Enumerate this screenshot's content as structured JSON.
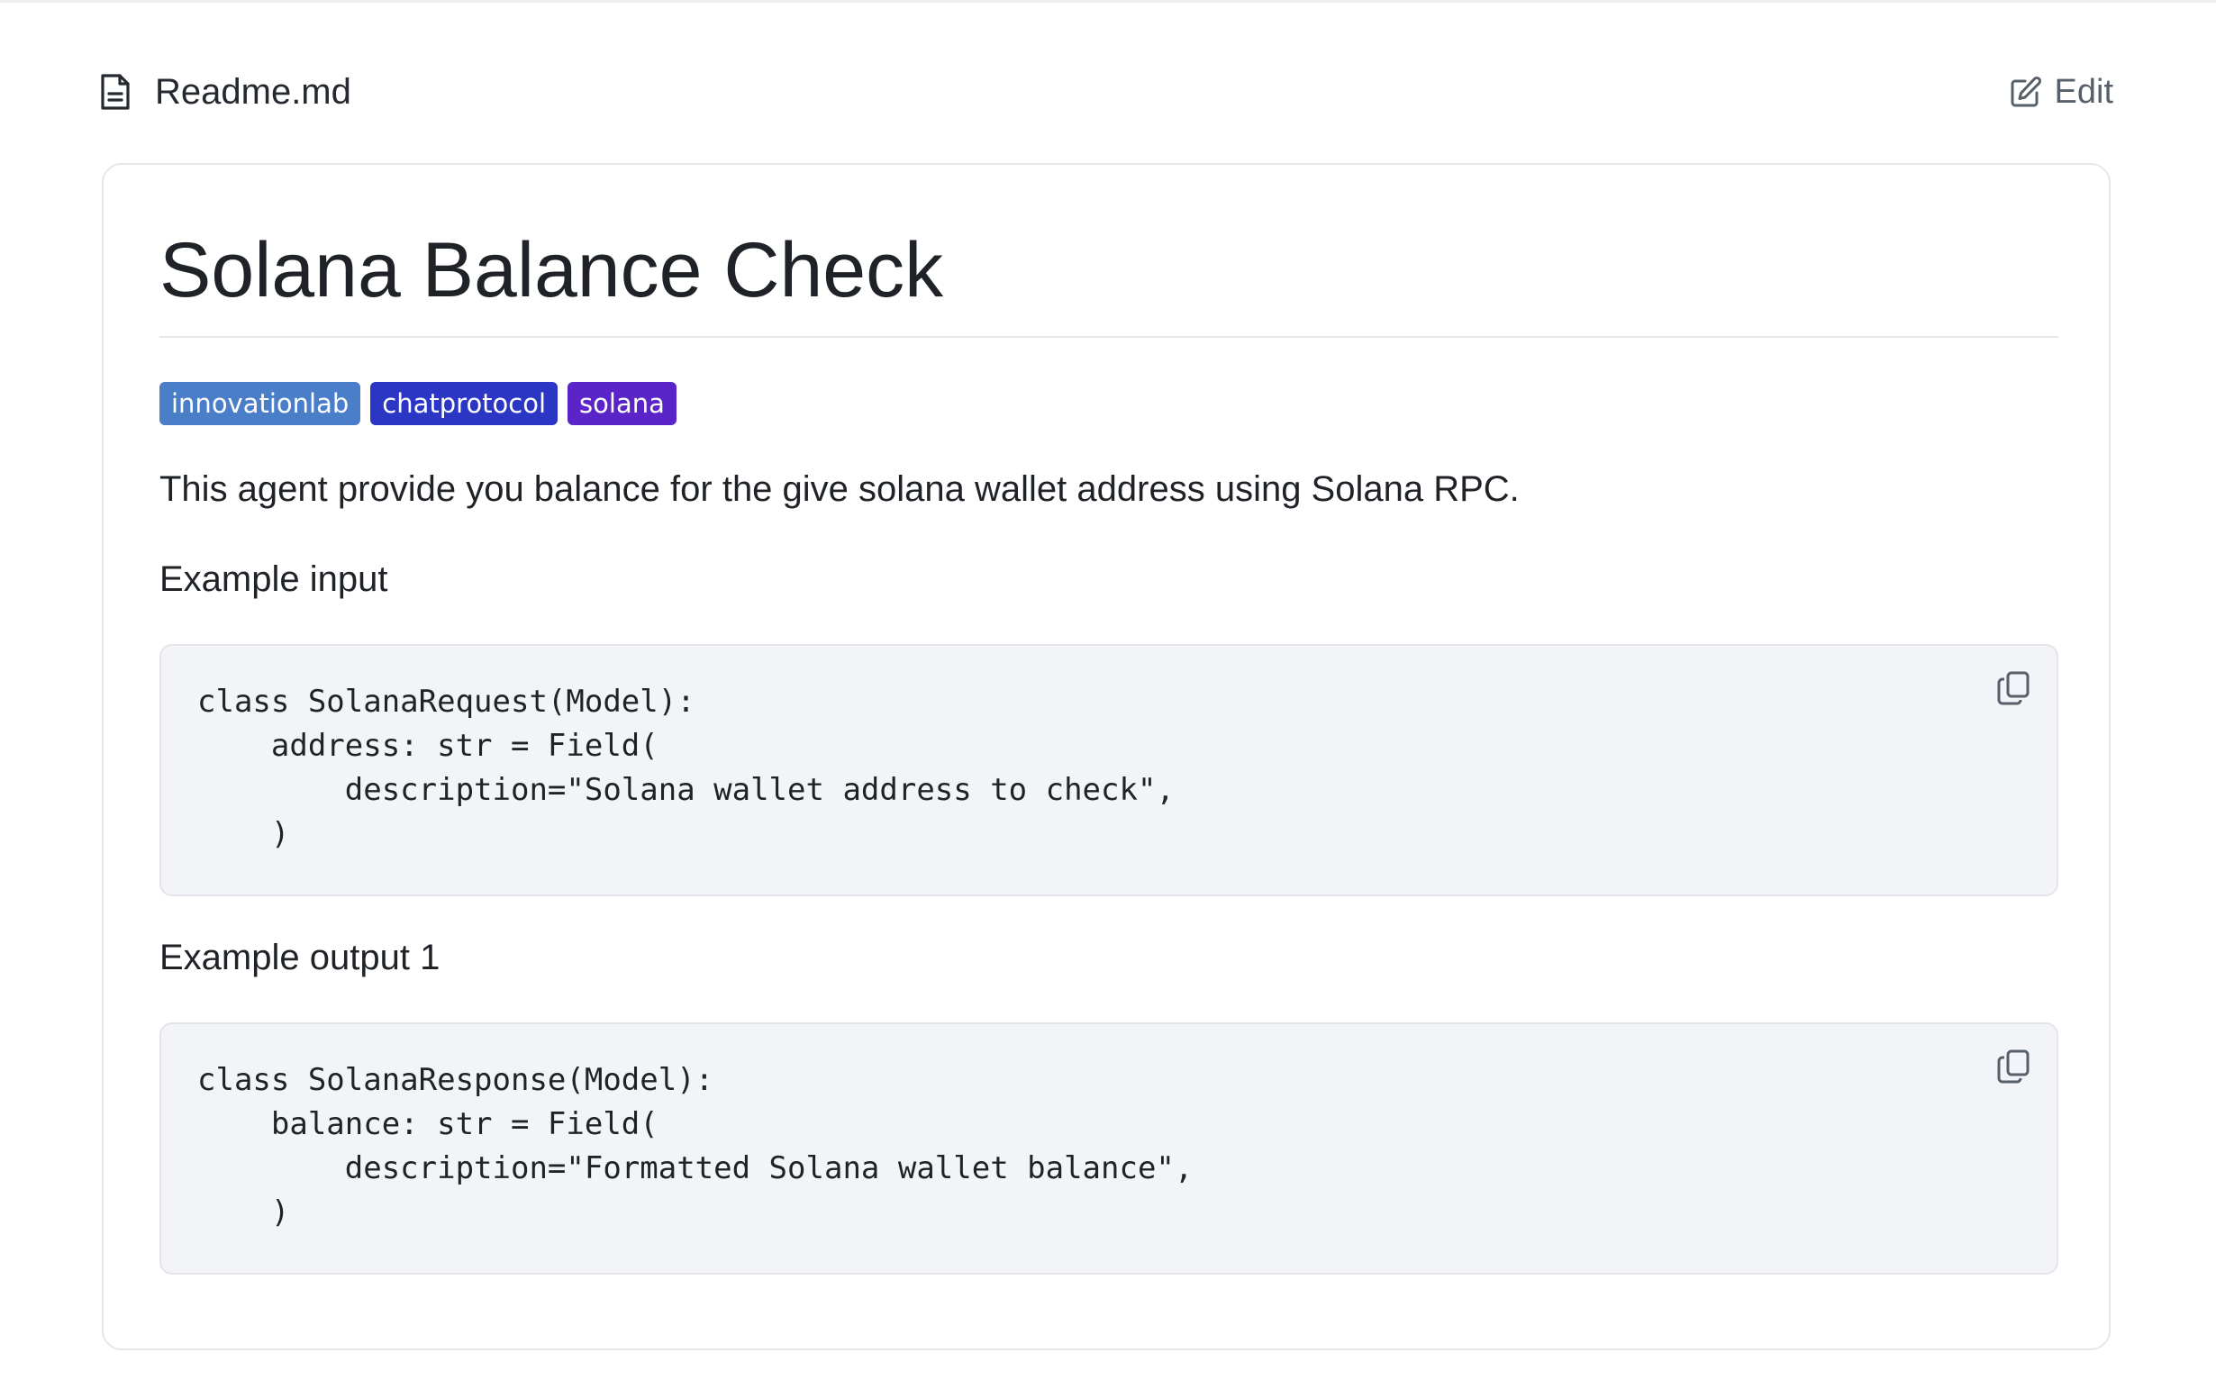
{
  "file_header": {
    "icon": "file-text-icon",
    "filename": "Readme.md",
    "edit_icon": "edit-icon",
    "edit_label": "Edit"
  },
  "readme": {
    "title": "Solana Balance Check",
    "badges": [
      {
        "label": "innovationlab",
        "color": "#4a7ec9"
      },
      {
        "label": "chatprotocol",
        "color": "#2b36c4"
      },
      {
        "label": "solana",
        "color": "#5b24c8"
      }
    ],
    "description": "This agent provide you balance for the give solana wallet address using Solana RPC.",
    "sections": [
      {
        "heading": "Example input",
        "code": "class SolanaRequest(Model):\n    address: str = Field(\n        description=\"Solana wallet address to check\",\n    )",
        "copy_icon": "copy-icon"
      },
      {
        "heading": "Example output 1",
        "code": "class SolanaResponse(Model):\n    balance: str = Field(\n        description=\"Formatted Solana wallet balance\",\n    )",
        "copy_icon": "copy-icon"
      }
    ]
  },
  "colors": {
    "text": "#1f2328",
    "muted": "#57606a",
    "code_bg": "#f3f4f8",
    "border": "#e5e7eb"
  }
}
